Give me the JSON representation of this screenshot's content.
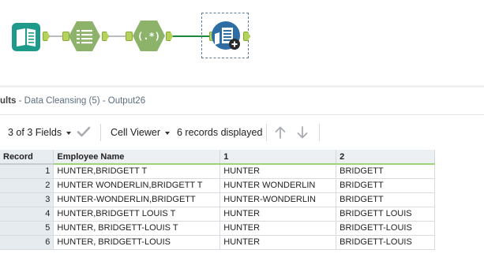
{
  "workflow": {
    "tools": [
      {
        "name": "input-data-tool",
        "icon": "book-icon",
        "color": "#1e9a8a"
      },
      {
        "name": "select-tool",
        "icon": "list-icon",
        "color": "#8db36a"
      },
      {
        "name": "regex-tool",
        "icon": "regex-icon",
        "label": "(.*)",
        "color": "#8db36a"
      },
      {
        "name": "browse-tool",
        "icon": "browse-icon",
        "color": "#2f6ea5"
      }
    ]
  },
  "results": {
    "title": "ults",
    "subtitle": " - Data Cleansing (5) - Output26"
  },
  "toolbar": {
    "fields_label": "3 of 3 Fields",
    "viewer_label": "Cell Viewer",
    "records_label": "6 records displayed"
  },
  "grid": {
    "columns": [
      "Record",
      "Employee Name",
      "1",
      "2"
    ],
    "rows": [
      {
        "record": "1",
        "employee_name": "HUNTER,BRIDGETT T",
        "c1": "HUNTER",
        "c2": "BRIDGETT"
      },
      {
        "record": "2",
        "employee_name": "HUNTER WONDERLIN,BRIDGETT T",
        "c1": "HUNTER WONDERLIN",
        "c2": "BRIDGETT"
      },
      {
        "record": "3",
        "employee_name": "HUNTER-WONDERLIN,BRIDGETT",
        "c1": "HUNTER-WONDERLIN",
        "c2": "BRIDGETT"
      },
      {
        "record": "4",
        "employee_name": "HUNTER,BRIDGETT LOUIS T",
        "c1": "HUNTER",
        "c2": "BRIDGETT LOUIS"
      },
      {
        "record": "5",
        "employee_name": "HUNTER, BRIDGETT-LOUIS T",
        "c1": "HUNTER",
        "c2": "BRIDGETT-LOUIS"
      },
      {
        "record": "6",
        "employee_name": "HUNTER, BRIDGETT-LOUIS",
        "c1": "HUNTER",
        "c2": "BRIDGETT-LOUIS"
      }
    ]
  }
}
